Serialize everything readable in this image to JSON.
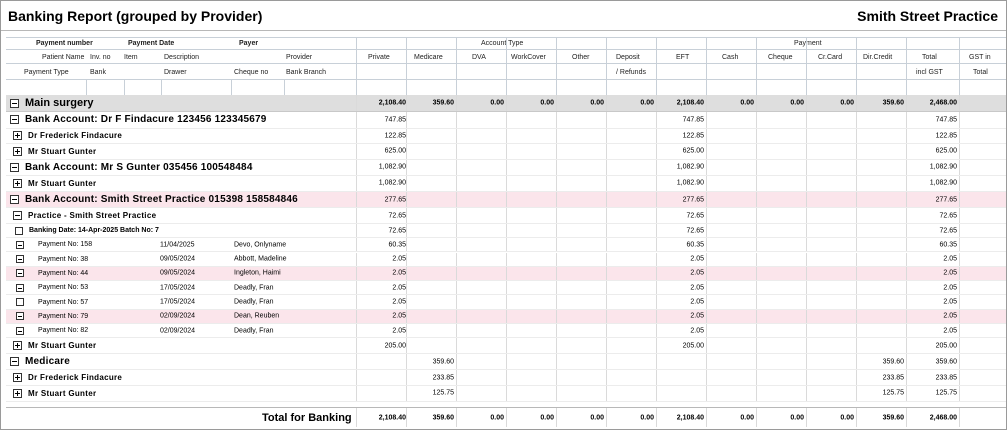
{
  "title": "Banking Report (grouped by Provider)",
  "practice": "Smith Street Practice",
  "header": {
    "payment_number": "Payment number",
    "payment_date": "Payment Date",
    "payer": "Payer",
    "patient_name": "Patient Name",
    "inv_no": "Inv. no",
    "item": "Item",
    "description": "Description",
    "provider": "Provider",
    "payment_type": "Payment Type",
    "bank": "Bank",
    "drawer": "Drawer",
    "cheque_no": "Cheque no",
    "bank_branch": "Bank Branch",
    "account_type": "Account Type",
    "payment": "Payment",
    "private": "Private",
    "medicare": "Medicare",
    "dva": "DVA",
    "workcover": "WorkCover",
    "other": "Other",
    "deposit": "Deposit",
    "refunds": "/ Refunds",
    "eft": "EFT",
    "cash": "Cash",
    "cheque": "Cheque",
    "cr_card": "Cr.Card",
    "dir_credit": "Dir.Credit",
    "total": "Total",
    "incl_gst": "incl GST",
    "gst_in": "GST in",
    "gst_total": "Total"
  },
  "rows": [
    {
      "level": 0,
      "type": "group",
      "label": "Main surgery",
      "expander": "minus",
      "cols": [
        "2,108.40",
        "359.60",
        "0.00",
        "0.00",
        "0.00",
        "0.00",
        "2,108.40",
        "0.00",
        "0.00",
        "0.00",
        "359.60",
        "2,468.00"
      ]
    },
    {
      "level": 1,
      "type": "bank",
      "label": "Bank Account: Dr F Findacure 123456 123345679",
      "expander": "minus",
      "cols": [
        "747.85",
        "",
        "",
        "",
        "",
        "",
        "747.85",
        "",
        "",
        "",
        "",
        "747.85"
      ]
    },
    {
      "level": 2,
      "type": "provider",
      "label": "Dr Frederick Findacure",
      "expander": "plus",
      "cols": [
        "122.85",
        "",
        "",
        "",
        "",
        "",
        "122.85",
        "",
        "",
        "",
        "",
        "122.85"
      ]
    },
    {
      "level": 2,
      "type": "provider",
      "label": "Mr Stuart Gunter",
      "expander": "plus",
      "cols": [
        "625.00",
        "",
        "",
        "",
        "",
        "",
        "625.00",
        "",
        "",
        "",
        "",
        "625.00"
      ]
    },
    {
      "level": 1,
      "type": "bank",
      "label": "Bank Account: Mr S Gunter 035456 100548484",
      "expander": "minus",
      "cols": [
        "1,082.90",
        "",
        "",
        "",
        "",
        "",
        "1,082.90",
        "",
        "",
        "",
        "",
        "1,082.90"
      ]
    },
    {
      "level": 2,
      "type": "provider",
      "label": "Mr Stuart Gunter",
      "expander": "plus",
      "cols": [
        "1,082.90",
        "",
        "",
        "",
        "",
        "",
        "1,082.90",
        "",
        "",
        "",
        "",
        "1,082.90"
      ]
    },
    {
      "level": 1,
      "type": "bank",
      "label": "Bank Account: Smith Street Practice 015398 158584846",
      "expander": "minus",
      "pink": true,
      "cols": [
        "277.65",
        "",
        "",
        "",
        "",
        "",
        "277.65",
        "",
        "",
        "",
        "",
        "277.65"
      ]
    },
    {
      "level": 2,
      "type": "provider",
      "label": "Practice - Smith Street Practice",
      "expander": "minus",
      "cols": [
        "72.65",
        "",
        "",
        "",
        "",
        "",
        "72.65",
        "",
        "",
        "",
        "",
        "72.65"
      ]
    },
    {
      "level": 3,
      "type": "batch",
      "label": "Banking Date: 14-Apr-2025 Batch No: 7",
      "expander": "empty",
      "cols": [
        "72.65",
        "",
        "",
        "",
        "",
        "",
        "72.65",
        "",
        "",
        "",
        "",
        "72.65"
      ]
    },
    {
      "level": 4,
      "type": "payment",
      "label": "Payment No: 158",
      "date": "11/04/2025",
      "payer": "Devo, Onlyname",
      "expander": "minus",
      "cols": [
        "60.35",
        "",
        "",
        "",
        "",
        "",
        "60.35",
        "",
        "",
        "",
        "",
        "60.35"
      ]
    },
    {
      "level": 4,
      "type": "payment",
      "label": "Payment No: 38",
      "date": "09/05/2024",
      "payer": "Abbott, Madeline",
      "expander": "minus",
      "cols": [
        "2.05",
        "",
        "",
        "",
        "",
        "",
        "2.05",
        "",
        "",
        "",
        "",
        "2.05"
      ]
    },
    {
      "level": 4,
      "type": "payment",
      "label": "Payment No: 44",
      "date": "09/05/2024",
      "payer": "Ingleton, Haimi",
      "expander": "minus",
      "pink": true,
      "cols": [
        "2.05",
        "",
        "",
        "",
        "",
        "",
        "2.05",
        "",
        "",
        "",
        "",
        "2.05"
      ]
    },
    {
      "level": 4,
      "type": "payment",
      "label": "Payment No: 53",
      "date": "17/05/2024",
      "payer": "Deadly, Fran",
      "expander": "minus",
      "cols": [
        "2.05",
        "",
        "",
        "",
        "",
        "",
        "2.05",
        "",
        "",
        "",
        "",
        "2.05"
      ]
    },
    {
      "level": 4,
      "type": "payment",
      "label": "Payment No: 57",
      "date": "17/05/2024",
      "payer": "Deadly, Fran",
      "expander": "empty",
      "cols": [
        "2.05",
        "",
        "",
        "",
        "",
        "",
        "2.05",
        "",
        "",
        "",
        "",
        "2.05"
      ]
    },
    {
      "level": 4,
      "type": "payment",
      "label": "Payment No: 79",
      "date": "02/09/2024",
      "payer": "Dean, Reuben",
      "expander": "minus",
      "pink": true,
      "cols": [
        "2.05",
        "",
        "",
        "",
        "",
        "",
        "2.05",
        "",
        "",
        "",
        "",
        "2.05"
      ]
    },
    {
      "level": 4,
      "type": "payment",
      "label": "Payment No: 82",
      "date": "02/09/2024",
      "payer": "Deadly, Fran",
      "expander": "minus",
      "cols": [
        "2.05",
        "",
        "",
        "",
        "",
        "",
        "2.05",
        "",
        "",
        "",
        "",
        "2.05"
      ]
    },
    {
      "level": 2,
      "type": "provider",
      "label": "Mr Stuart Gunter",
      "expander": "plus",
      "cols": [
        "205.00",
        "",
        "",
        "",
        "",
        "",
        "205.00",
        "",
        "",
        "",
        "",
        "205.00"
      ]
    },
    {
      "level": 1,
      "type": "bank",
      "label": "Medicare",
      "expander": "minus",
      "cols": [
        "",
        "359.60",
        "",
        "",
        "",
        "",
        "",
        "",
        "",
        "",
        "359.60",
        "359.60"
      ]
    },
    {
      "level": 2,
      "type": "provider",
      "label": "Dr Frederick Findacure",
      "expander": "plus",
      "cols": [
        "",
        "233.85",
        "",
        "",
        "",
        "",
        "",
        "",
        "",
        "",
        "233.85",
        "233.85"
      ]
    },
    {
      "level": 2,
      "type": "provider",
      "label": "Mr Stuart Gunter",
      "expander": "plus",
      "cols": [
        "",
        "125.75",
        "",
        "",
        "",
        "",
        "",
        "",
        "",
        "",
        "125.75",
        "125.75"
      ]
    }
  ],
  "total": {
    "label": "Total for Banking",
    "cols": [
      "2,108.40",
      "359.60",
      "0.00",
      "0.00",
      "0.00",
      "0.00",
      "2,108.40",
      "0.00",
      "0.00",
      "0.00",
      "359.60",
      "2,468.00"
    ]
  }
}
